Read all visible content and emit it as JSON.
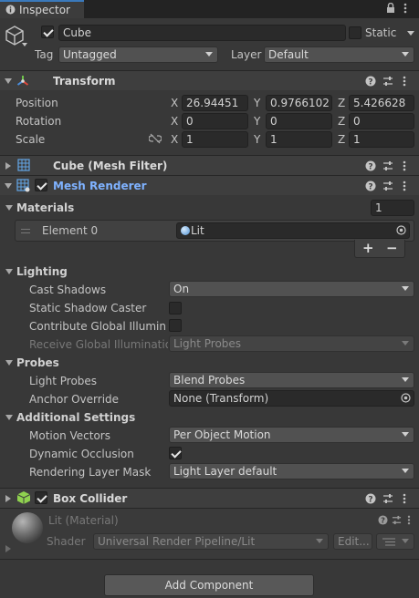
{
  "tab": {
    "title": "Inspector"
  },
  "object": {
    "name": "Cube",
    "static_label": "Static",
    "tag_label": "Tag",
    "tag_value": "Untagged",
    "layer_label": "Layer",
    "layer_value": "Default"
  },
  "transform": {
    "title": "Transform",
    "position_label": "Position",
    "rotation_label": "Rotation",
    "scale_label": "Scale",
    "x": "X",
    "y": "Y",
    "z": "Z",
    "position": [
      "26.94451",
      "0.9766102",
      "5.426628"
    ],
    "rotation": [
      "0",
      "0",
      "0"
    ],
    "scale": [
      "1",
      "1",
      "1"
    ]
  },
  "mesh_filter": {
    "title": "Cube (Mesh Filter)"
  },
  "mesh_renderer": {
    "title": "Mesh Renderer",
    "materials_label": "Materials",
    "materials_count": "1",
    "element0_label": "Element 0",
    "element0_value": "Lit",
    "add_label": "+",
    "remove_label": "−",
    "lighting": {
      "title": "Lighting",
      "cast_shadows_label": "Cast Shadows",
      "cast_shadows_value": "On",
      "static_shadow_label": "Static Shadow Caster",
      "contribute_gi_label": "Contribute Global Illuminati",
      "receive_gi_label": "Receive Global Illumination",
      "receive_gi_value": "Light Probes"
    },
    "probes": {
      "title": "Probes",
      "light_probes_label": "Light Probes",
      "light_probes_value": "Blend Probes",
      "anchor_label": "Anchor Override",
      "anchor_value": "None (Transform)"
    },
    "additional": {
      "title": "Additional Settings",
      "motion_label": "Motion Vectors",
      "motion_value": "Per Object Motion",
      "dynamic_occlusion_label": "Dynamic Occlusion",
      "rendering_mask_label": "Rendering Layer Mask",
      "rendering_mask_value": "Light Layer default"
    }
  },
  "box_collider": {
    "title": "Box Collider"
  },
  "material": {
    "title": "Lit (Material)",
    "shader_label": "Shader",
    "shader_value": "Universal Render Pipeline/Lit",
    "edit_label": "Edit..."
  },
  "add_component": {
    "label": "Add Component"
  },
  "colors": {
    "accent": "#3a79bb",
    "link": "#7fb2ff",
    "background": "#383838",
    "header": "#3e3e3e"
  }
}
